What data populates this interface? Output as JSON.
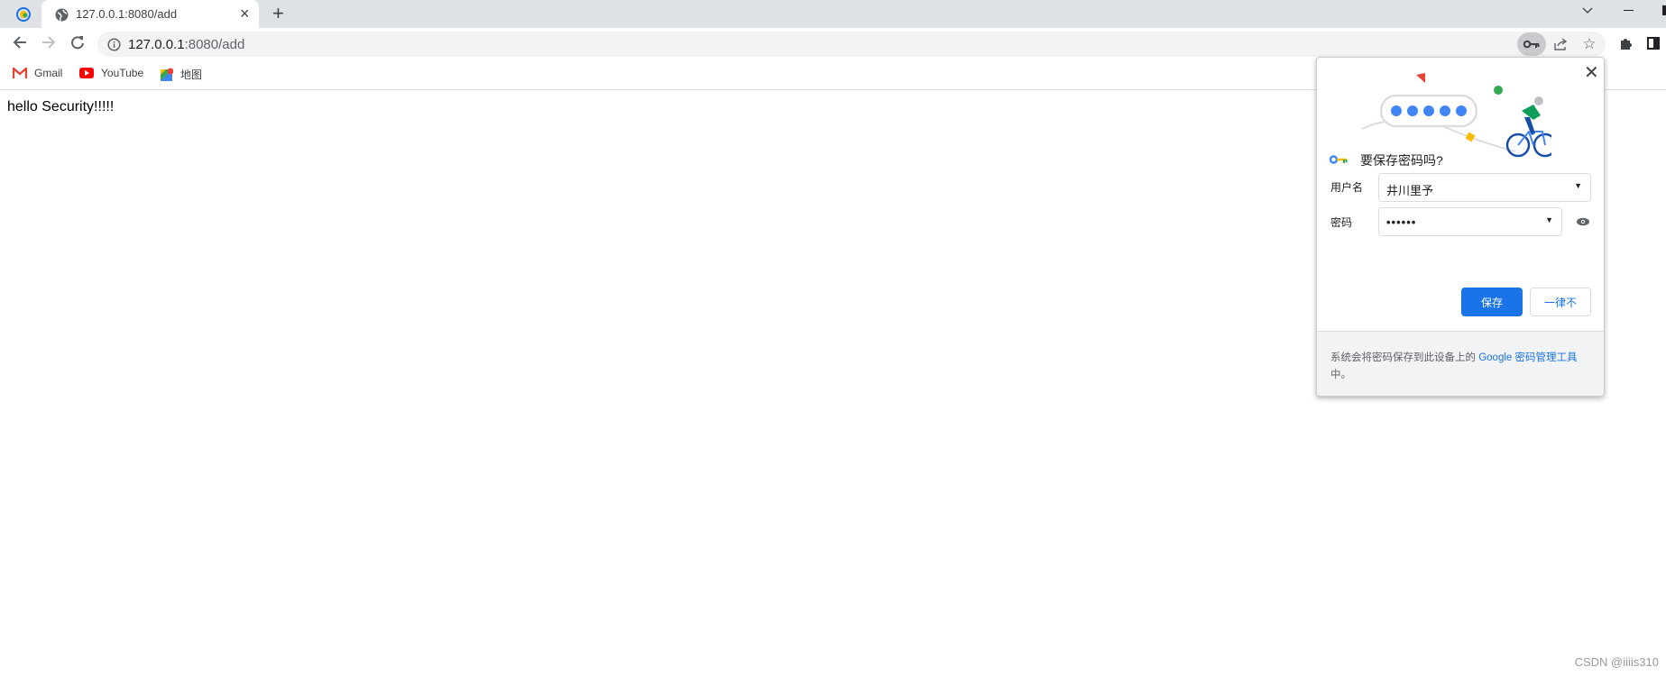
{
  "browser": {
    "tab": {
      "title": "127.0.0.1:8080/add",
      "close": "×"
    },
    "new_tab": "+",
    "url_host": "127.0.0.1",
    "url_rest": ":8080/add",
    "bookmarks": [
      {
        "label": "Gmail",
        "icon": "gmail-icon"
      },
      {
        "label": "YouTube",
        "icon": "youtube-icon"
      },
      {
        "label": "地图",
        "icon": "maps-icon"
      }
    ]
  },
  "page": {
    "text": "hello Security!!!!!"
  },
  "save_password": {
    "title": "要保存密码吗?",
    "username_label": "用户名",
    "username_value": "井川里予",
    "password_label": "密码",
    "password_value": "••••••",
    "save_button": "保存",
    "never_button": "一律不",
    "footer_text": "系统会将密码保存到此设备上的 ",
    "footer_link": "Google 密码管理工具",
    "footer_end": "中。",
    "accent": "#1a73e8"
  },
  "watermark": "CSDN @iiiis310"
}
